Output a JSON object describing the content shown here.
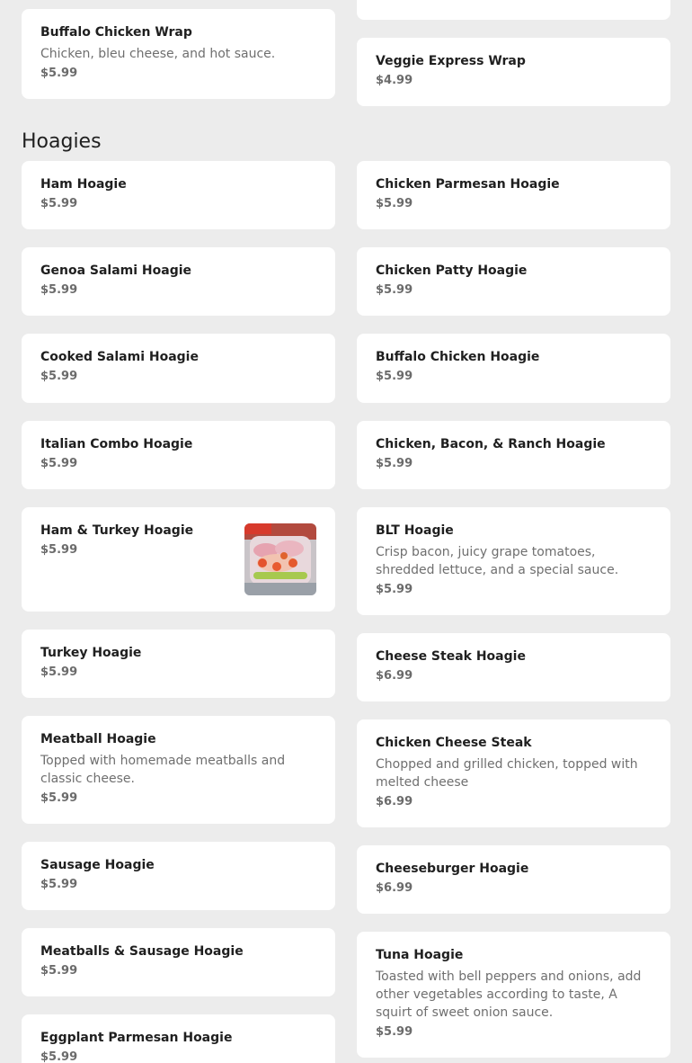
{
  "wraps": {
    "buffalo_chicken_wrap": {
      "name": "Buffalo Chicken Wrap",
      "desc": "Chicken, bleu cheese, and hot sauce.",
      "price": "$5.99"
    },
    "veggie_express_wrap": {
      "name": "Veggie Express Wrap",
      "price": "$4.99"
    }
  },
  "section": {
    "title": "Hoagies"
  },
  "left": [
    {
      "name": "Ham Hoagie",
      "price": "$5.99"
    },
    {
      "name": "Genoa Salami Hoagie",
      "price": "$5.99"
    },
    {
      "name": "Cooked Salami Hoagie",
      "price": "$5.99"
    },
    {
      "name": "Italian Combo Hoagie",
      "price": "$5.99"
    },
    {
      "name": "Ham & Turkey Hoagie",
      "price": "$5.99"
    },
    {
      "name": "Turkey Hoagie",
      "price": "$5.99"
    },
    {
      "name": "Meatball Hoagie",
      "desc": "Topped with homemade meatballs and classic cheese.",
      "price": "$5.99"
    },
    {
      "name": "Sausage Hoagie",
      "price": "$5.99"
    },
    {
      "name": "Meatballs & Sausage Hoagie",
      "price": "$5.99"
    },
    {
      "name": "Eggplant Parmesan Hoagie",
      "price": "$5.99"
    }
  ],
  "right": [
    {
      "name": "Chicken Parmesan Hoagie",
      "price": "$5.99"
    },
    {
      "name": "Chicken Patty Hoagie",
      "price": "$5.99"
    },
    {
      "name": "Buffalo Chicken Hoagie",
      "price": "$5.99"
    },
    {
      "name": "Chicken, Bacon, & Ranch Hoagie",
      "price": "$5.99"
    },
    {
      "name": "BLT Hoagie",
      "desc": "Crisp bacon, juicy grape tomatoes, shredded lettuce, and a special sauce.",
      "price": "$5.99"
    },
    {
      "name": "Cheese Steak Hoagie",
      "price": "$6.99"
    },
    {
      "name": "Chicken Cheese Steak",
      "desc": "Chopped and grilled chicken, topped with melted cheese",
      "price": "$6.99"
    },
    {
      "name": "Cheeseburger Hoagie",
      "price": "$6.99"
    },
    {
      "name": "Tuna Hoagie",
      "desc": "Toasted with bell peppers and onions, add other vegetables according to taste, A squirt of sweet onion sauce.",
      "price": "$5.99"
    }
  ]
}
